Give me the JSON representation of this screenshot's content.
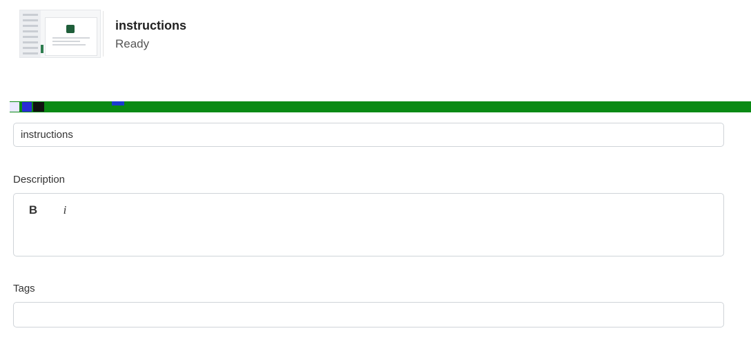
{
  "header": {
    "title": "instructions",
    "status": "Ready",
    "thumbnail_icon": "document-thumbnail-icon"
  },
  "form": {
    "name_value": "instructions",
    "description": {
      "label": "Description",
      "bold_label": "B",
      "italic_label": "i",
      "content": ""
    },
    "tags": {
      "label": "Tags",
      "value": ""
    }
  },
  "colors": {
    "border": "#cfd3d8",
    "accent_green": "#0a8a14",
    "text": "#333333"
  }
}
